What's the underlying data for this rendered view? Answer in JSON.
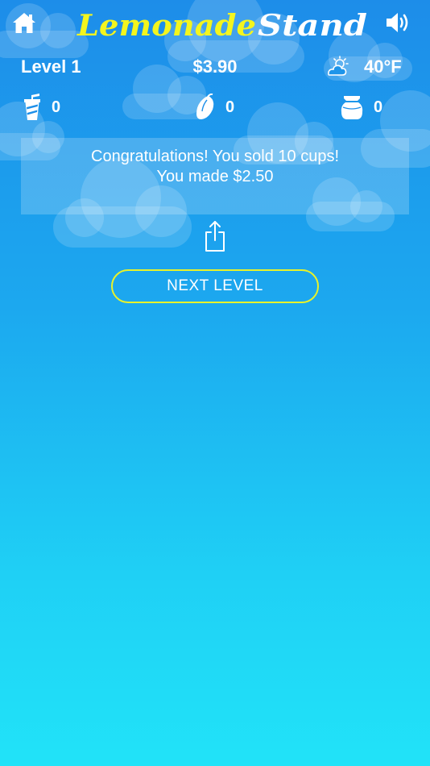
{
  "app": {
    "title_part1": "Lemonade",
    "title_part2": "Stand",
    "accent_yellow": "#f3f51e",
    "button_border": "#e8f22a"
  },
  "header": {
    "home_icon": "home-icon",
    "sound_icon": "speaker-volume-icon"
  },
  "stats": {
    "level": "Level 1",
    "money": "$3.90",
    "weather_icon": "partly-cloudy-sun-icon",
    "temperature": "40°F"
  },
  "inventory": [
    {
      "icon": "cup-icon",
      "count": "0"
    },
    {
      "icon": "lemon-icon",
      "count": "0"
    },
    {
      "icon": "sugar-bag-icon",
      "count": "0"
    }
  ],
  "message": {
    "line1": "Congratulations! You sold 10 cups!",
    "line2": "You made $2.50"
  },
  "actions": {
    "share_icon": "share-icon",
    "next_level": "NEXT LEVEL"
  }
}
